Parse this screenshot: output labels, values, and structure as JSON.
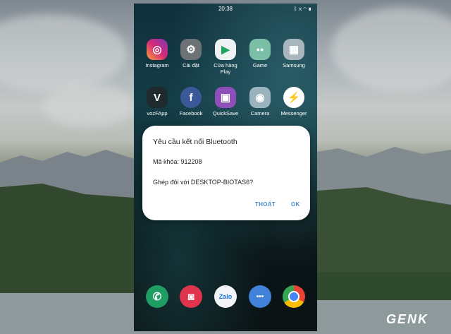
{
  "status_bar": {
    "time": "20:38",
    "icons": [
      "bluetooth-icon",
      "silent-icon",
      "wifi-icon",
      "battery-icon"
    ]
  },
  "home_apps": [
    {
      "label": "Instagram",
      "glyph": "◎",
      "color": "#c13584"
    },
    {
      "label": "Cài đặt",
      "glyph": "⚙",
      "color": "#6d7275"
    },
    {
      "label": "Cửa hàng Play",
      "glyph": "▶",
      "color": "#e9eef0"
    },
    {
      "label": "Game",
      "glyph": "●●",
      "color": "#7bbfa6"
    },
    {
      "label": "Samsung",
      "glyph": "▦",
      "color": "#a8b6bd"
    },
    {
      "label": "vozFApp",
      "glyph": "V",
      "color": "#1e2a2e"
    },
    {
      "label": "Facebook",
      "glyph": "f",
      "color": "#3b5998"
    },
    {
      "label": "QuickSave",
      "glyph": "▣",
      "color": "#8e4fb8"
    },
    {
      "label": "Camera",
      "glyph": "◉",
      "color": "#9bb3bd"
    },
    {
      "label": "Messenger",
      "glyph": "⚡",
      "color": "#ffffff"
    }
  ],
  "dock_apps": [
    {
      "label": "phone",
      "glyph": "✆",
      "color": "#1f9e64"
    },
    {
      "label": "camera-app",
      "glyph": "◙",
      "color": "#e0344e"
    },
    {
      "label": "Zalo",
      "glyph": "Zalo",
      "color": "#f2f5f7"
    },
    {
      "label": "messages",
      "glyph": "•••",
      "color": "#3f82d8"
    },
    {
      "label": "chrome",
      "glyph": "◕",
      "color": "#f1f1f1"
    }
  ],
  "dialog": {
    "title": "Yêu cầu kết nối Bluetooth",
    "passkey": "Mã khóa: 912208",
    "pair_prompt": "Ghép đôi với DESKTOP-BIOTAS6?",
    "cancel_label": "THOÁT",
    "ok_label": "OK"
  },
  "watermark": "GENK"
}
